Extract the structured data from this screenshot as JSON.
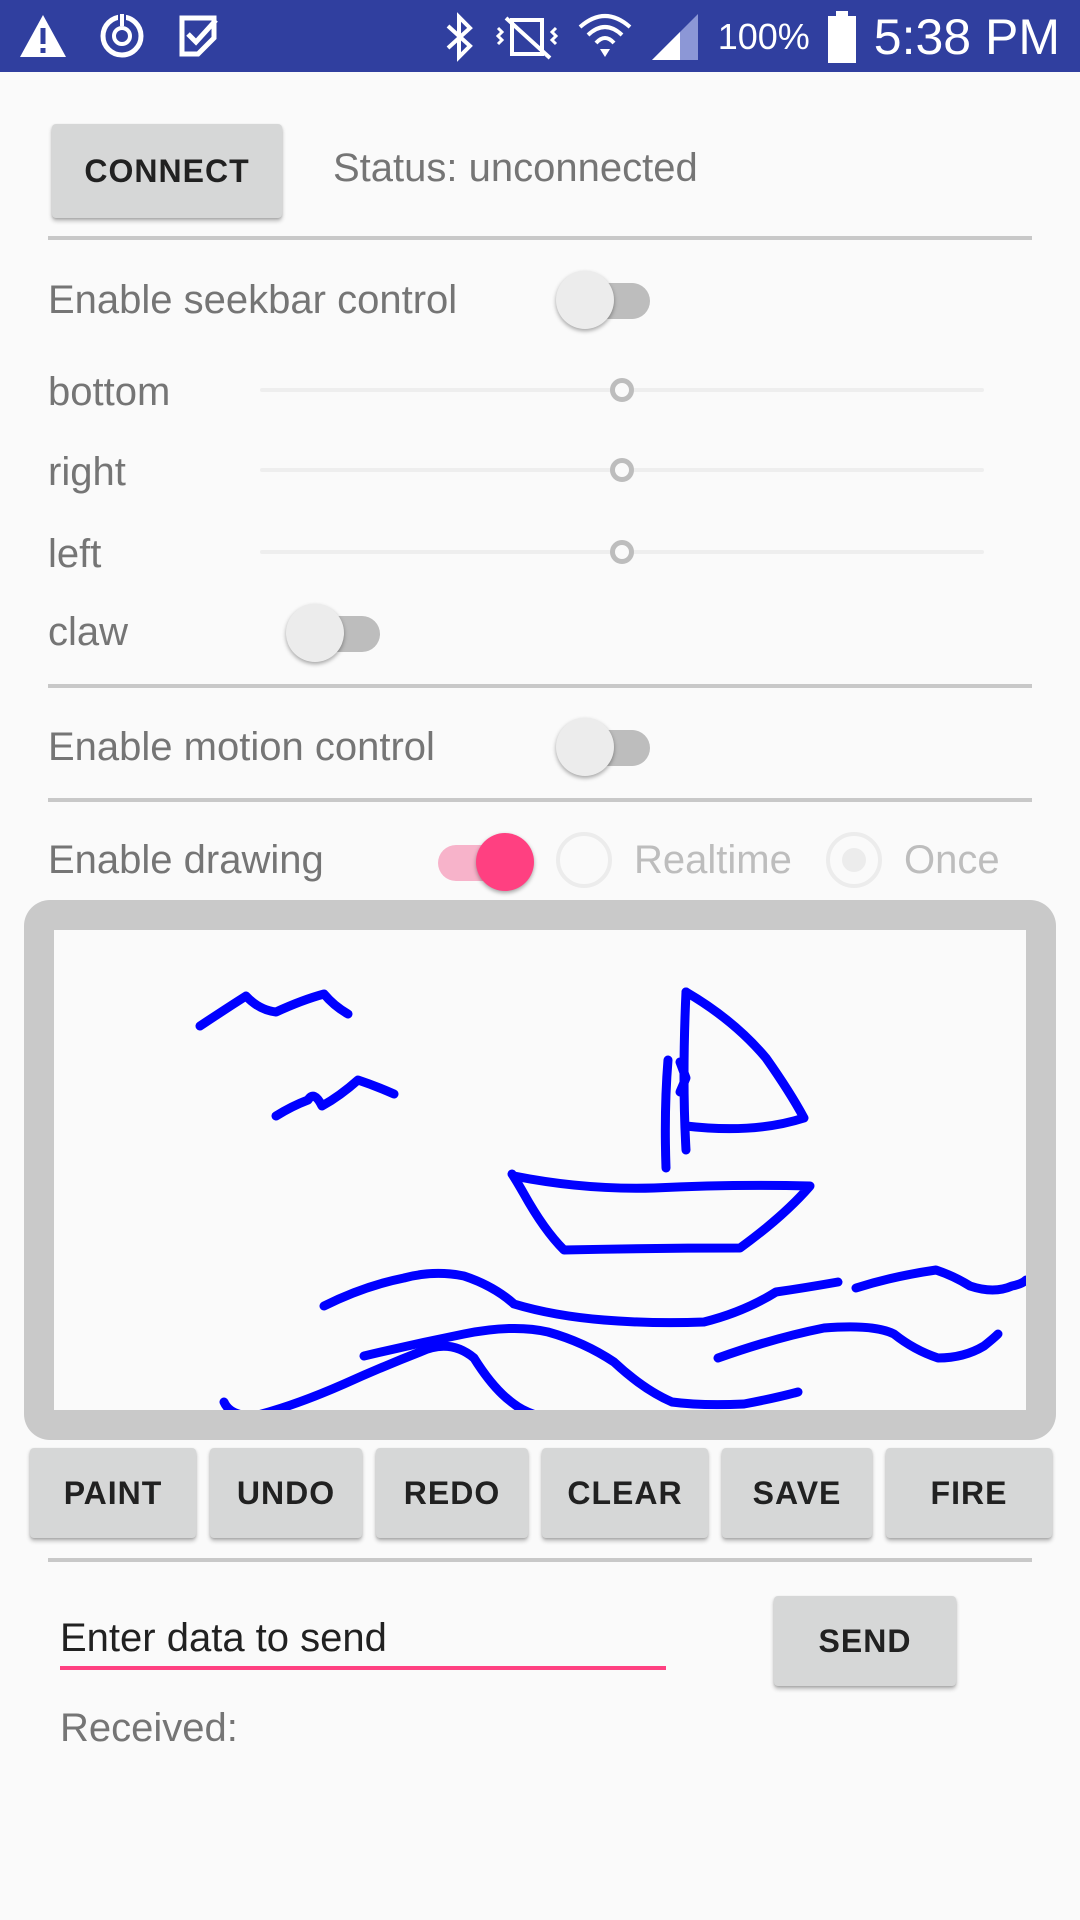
{
  "status_bar": {
    "left_icons": [
      "warning-icon",
      "sync-icon",
      "task-check-icon"
    ],
    "right_icons": [
      "bluetooth-icon",
      "vibrate-icon",
      "wifi-icon",
      "signal-icon",
      "battery-icon"
    ],
    "battery": "100%",
    "time": "5:38 PM",
    "background": "#303f9f"
  },
  "connection": {
    "connect_label": "CONNECT",
    "status": "Status: unconnected"
  },
  "seekbar_section": {
    "enable_label": "Enable seekbar control",
    "enabled": false,
    "sliders": [
      {
        "label": "bottom",
        "value": 0.5
      },
      {
        "label": "right",
        "value": 0.5
      },
      {
        "label": "left",
        "value": 0.5
      }
    ],
    "claw_label": "claw",
    "claw_on": false
  },
  "motion_section": {
    "enable_label": "Enable motion control",
    "enabled": false
  },
  "drawing_section": {
    "enable_label": "Enable drawing",
    "enabled": true,
    "modes": [
      {
        "label": "Realtime",
        "selected": false
      },
      {
        "label": "Once",
        "selected": true
      }
    ],
    "stroke_color": "#0000ff"
  },
  "toolbar": {
    "paint": "PAINT",
    "undo": "UNDO",
    "redo": "REDO",
    "clear": "CLEAR",
    "save": "SAVE",
    "fire": "FIRE"
  },
  "send_section": {
    "placeholder": "Enter data to send",
    "send_label": "SEND",
    "received_label": "Received:"
  },
  "colors": {
    "accent": "#ff4081",
    "primary_dark": "#303f9f"
  }
}
